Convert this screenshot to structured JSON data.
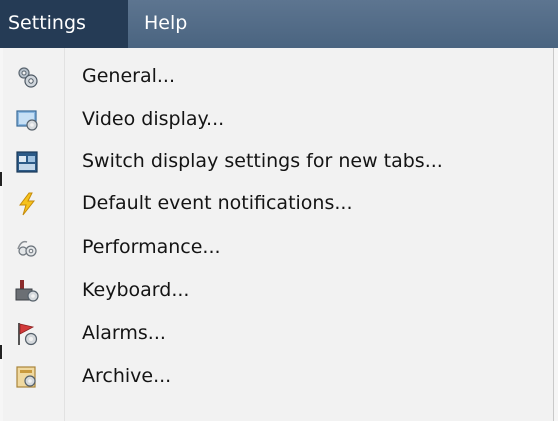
{
  "menubar": {
    "settings_label": "Settings",
    "help_label": "Help"
  },
  "settings_menu": {
    "items": [
      {
        "label": "General...",
        "icon": "gears-icon"
      },
      {
        "label": "Video display...",
        "icon": "video-display-icon"
      },
      {
        "label": "Switch display settings for new tabs...",
        "icon": "switch-display-icon"
      },
      {
        "label": "Default event notifications...",
        "icon": "lightning-icon"
      },
      {
        "label": "Performance...",
        "icon": "performance-gears-icon"
      },
      {
        "label": "Keyboard...",
        "icon": "keyboard-icon"
      },
      {
        "label": "Alarms...",
        "icon": "alarm-flag-icon"
      },
      {
        "label": "Archive...",
        "icon": "archive-icon"
      }
    ]
  }
}
